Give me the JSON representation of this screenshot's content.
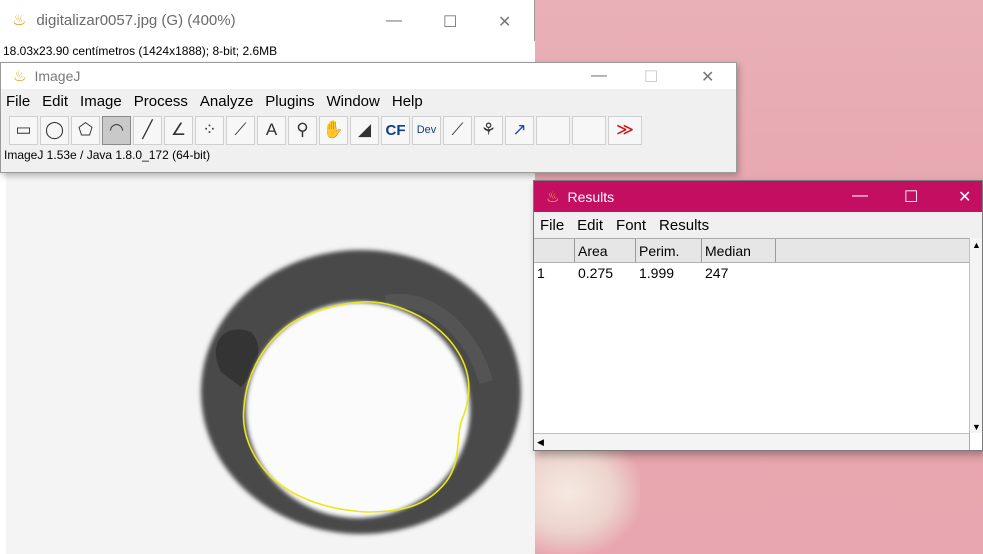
{
  "image_window": {
    "title": "digitalizar0057.jpg (G) (400%)",
    "info": "18.03x23.90 centímetros (1424x1888); 8-bit; 2.6MB",
    "controls": {
      "minimize": "—",
      "maximize": "☐",
      "close": "✕"
    }
  },
  "imagej": {
    "title": "ImageJ",
    "menus": [
      "File",
      "Edit",
      "Image",
      "Process",
      "Analyze",
      "Plugins",
      "Window",
      "Help"
    ],
    "tools": [
      {
        "name": "rectangle-tool",
        "glyph": "▭"
      },
      {
        "name": "oval-tool",
        "glyph": "◯"
      },
      {
        "name": "polygon-tool",
        "glyph": "⬠"
      },
      {
        "name": "freehand-tool",
        "glyph": "◠",
        "active": true
      },
      {
        "name": "line-tool",
        "glyph": "╱"
      },
      {
        "name": "angle-tool",
        "glyph": "∠"
      },
      {
        "name": "point-tool",
        "glyph": "⁘"
      },
      {
        "name": "wand-tool",
        "glyph": "⟋"
      },
      {
        "name": "text-tool",
        "glyph": "A"
      },
      {
        "name": "magnifier-tool",
        "glyph": "⚲"
      },
      {
        "name": "hand-tool",
        "glyph": "✋"
      },
      {
        "name": "dropper-tool",
        "glyph": "◢"
      },
      {
        "name": "cf-tool",
        "glyph": "CF"
      },
      {
        "name": "dev-tool",
        "glyph": "Dev"
      },
      {
        "name": "brush-tool",
        "glyph": "⟋"
      },
      {
        "name": "flood-tool",
        "glyph": "⚘"
      },
      {
        "name": "arrow-tool",
        "glyph": "↗"
      },
      {
        "name": "empty-slot-1",
        "glyph": ""
      },
      {
        "name": "empty-slot-2",
        "glyph": ""
      },
      {
        "name": "more-tools",
        "glyph": "≫"
      }
    ],
    "status": "ImageJ 1.53e / Java 1.8.0_172 (64-bit)",
    "controls": {
      "minimize": "—",
      "maximize": "☐",
      "close": "✕"
    }
  },
  "results": {
    "title": "Results",
    "menus": [
      "File",
      "Edit",
      "Font",
      "Results"
    ],
    "columns": [
      "Area",
      "Perim.",
      "Median"
    ],
    "rows": [
      {
        "index": "1",
        "cells": [
          "0.275",
          "1.999",
          "247"
        ]
      }
    ],
    "controls": {
      "minimize": "—",
      "maximize": "☐",
      "close": "✕"
    },
    "accent": "#c40e62"
  }
}
